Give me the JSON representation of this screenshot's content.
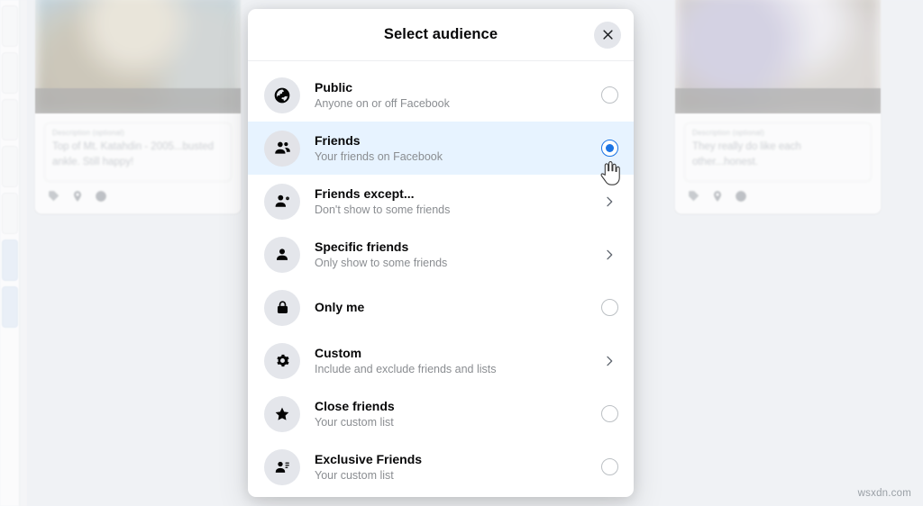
{
  "background": {
    "page_bg_color": "#f0f2f5",
    "cards": [
      {
        "photo_alt": "mountain-summit-photo",
        "desc_label": "Description (optional)",
        "desc_text": "Top of Mt. Katahdin - 2005...busted ankle.  Still happy!",
        "icons": [
          "tag-icon",
          "location-pin-icon",
          "clock-icon"
        ]
      },
      {
        "photo_alt": "two-kids-photo",
        "desc_label": "Description (optional)",
        "desc_text": "They really do like each other...honest.",
        "icons": [
          "tag-icon",
          "location-pin-icon",
          "clock-icon"
        ]
      }
    ]
  },
  "dialog": {
    "title": "Select audience",
    "close_icon": "close-icon",
    "accent_color": "#1b74e4",
    "selected_row_bg": "#e7f3ff",
    "options": [
      {
        "id": "public",
        "label": "Public",
        "sub": "Anyone on or off Facebook",
        "icon": "globe-icon",
        "control": "radio",
        "selected": false
      },
      {
        "id": "friends",
        "label": "Friends",
        "sub": "Your friends on Facebook",
        "icon": "two-people-icon",
        "control": "radio",
        "selected": true
      },
      {
        "id": "friends-except",
        "label": "Friends except...",
        "sub": "Don't show to some friends",
        "icon": "person-minus-icon",
        "control": "chevron",
        "selected": false
      },
      {
        "id": "specific-friends",
        "label": "Specific friends",
        "sub": "Only show to some friends",
        "icon": "person-icon",
        "control": "chevron",
        "selected": false
      },
      {
        "id": "only-me",
        "label": "Only me",
        "sub": "",
        "icon": "lock-icon",
        "control": "radio",
        "selected": false
      },
      {
        "id": "custom",
        "label": "Custom",
        "sub": "Include and exclude friends and lists",
        "icon": "gear-icon",
        "control": "chevron",
        "selected": false
      },
      {
        "id": "close-friends",
        "label": "Close friends",
        "sub": "Your custom list",
        "icon": "star-icon",
        "control": "radio",
        "selected": false
      },
      {
        "id": "exclusive-friends",
        "label": "Exclusive Friends",
        "sub": "Your custom list",
        "icon": "person-list-icon",
        "control": "radio",
        "selected": false
      }
    ]
  },
  "cursor": {
    "icon": "pointing-hand-cursor"
  },
  "watermark": {
    "text": "wsxdn.com"
  }
}
